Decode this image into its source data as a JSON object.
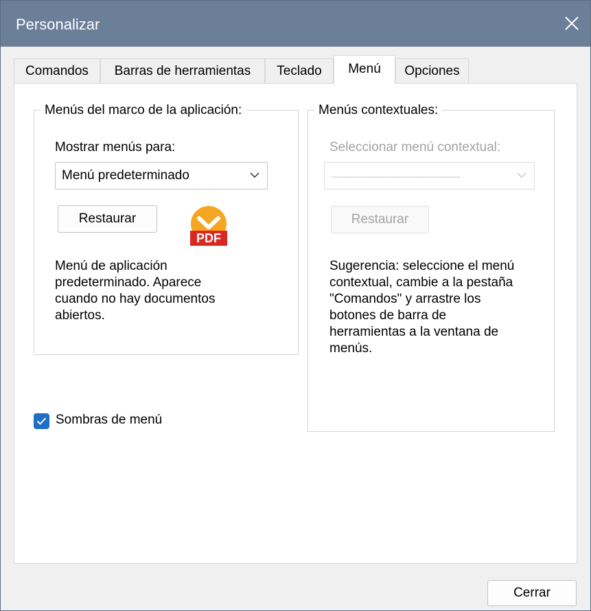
{
  "window": {
    "title": "Personalizar"
  },
  "tabs": [
    {
      "label": "Comandos"
    },
    {
      "label": "Barras de herramientas"
    },
    {
      "label": "Teclado"
    },
    {
      "label": "Menú"
    },
    {
      "label": "Opciones"
    }
  ],
  "active_tab": "Menú",
  "app_menus": {
    "group_title": "Menús del marco de la aplicación:",
    "show_for_label": "Mostrar menús para:",
    "selected_menu": "Menú predeterminado",
    "reset_label": "Restaurar",
    "description": "Menú de aplicación predeterminado. Aparece cuando no hay documentos abiertos.",
    "description_lines": [
      "Menú de aplicación",
      "predeterminado. Aparece",
      "cuando no hay documentos",
      "abiertos."
    ],
    "icon": "pdf-icon",
    "icon_badge_text": "PDF"
  },
  "context_menus": {
    "group_title": "Menús contextuales:",
    "select_label": "Seleccionar menú contextual:",
    "selected_value": "------------------------------------------------------",
    "reset_label": "Restaurar",
    "hint_lines": [
      "Sugerencia: seleccione el menú",
      "contextual, cambie a la pestaña",
      "\"Comandos\" y arrastre los",
      "botones de barra de",
      "herramientas a la ventana de",
      "menús."
    ]
  },
  "menu_shadows": {
    "label": "Sombras de menú",
    "checked": true
  },
  "footer": {
    "close_label": "Cerrar"
  },
  "colors": {
    "titlebar": "#6b7f99",
    "checkbox_accent": "#1f6fc5",
    "pdf_icon_orange": "#f5a623",
    "pdf_icon_red": "#d9281f",
    "disabled_text": "#a3a3a3"
  }
}
